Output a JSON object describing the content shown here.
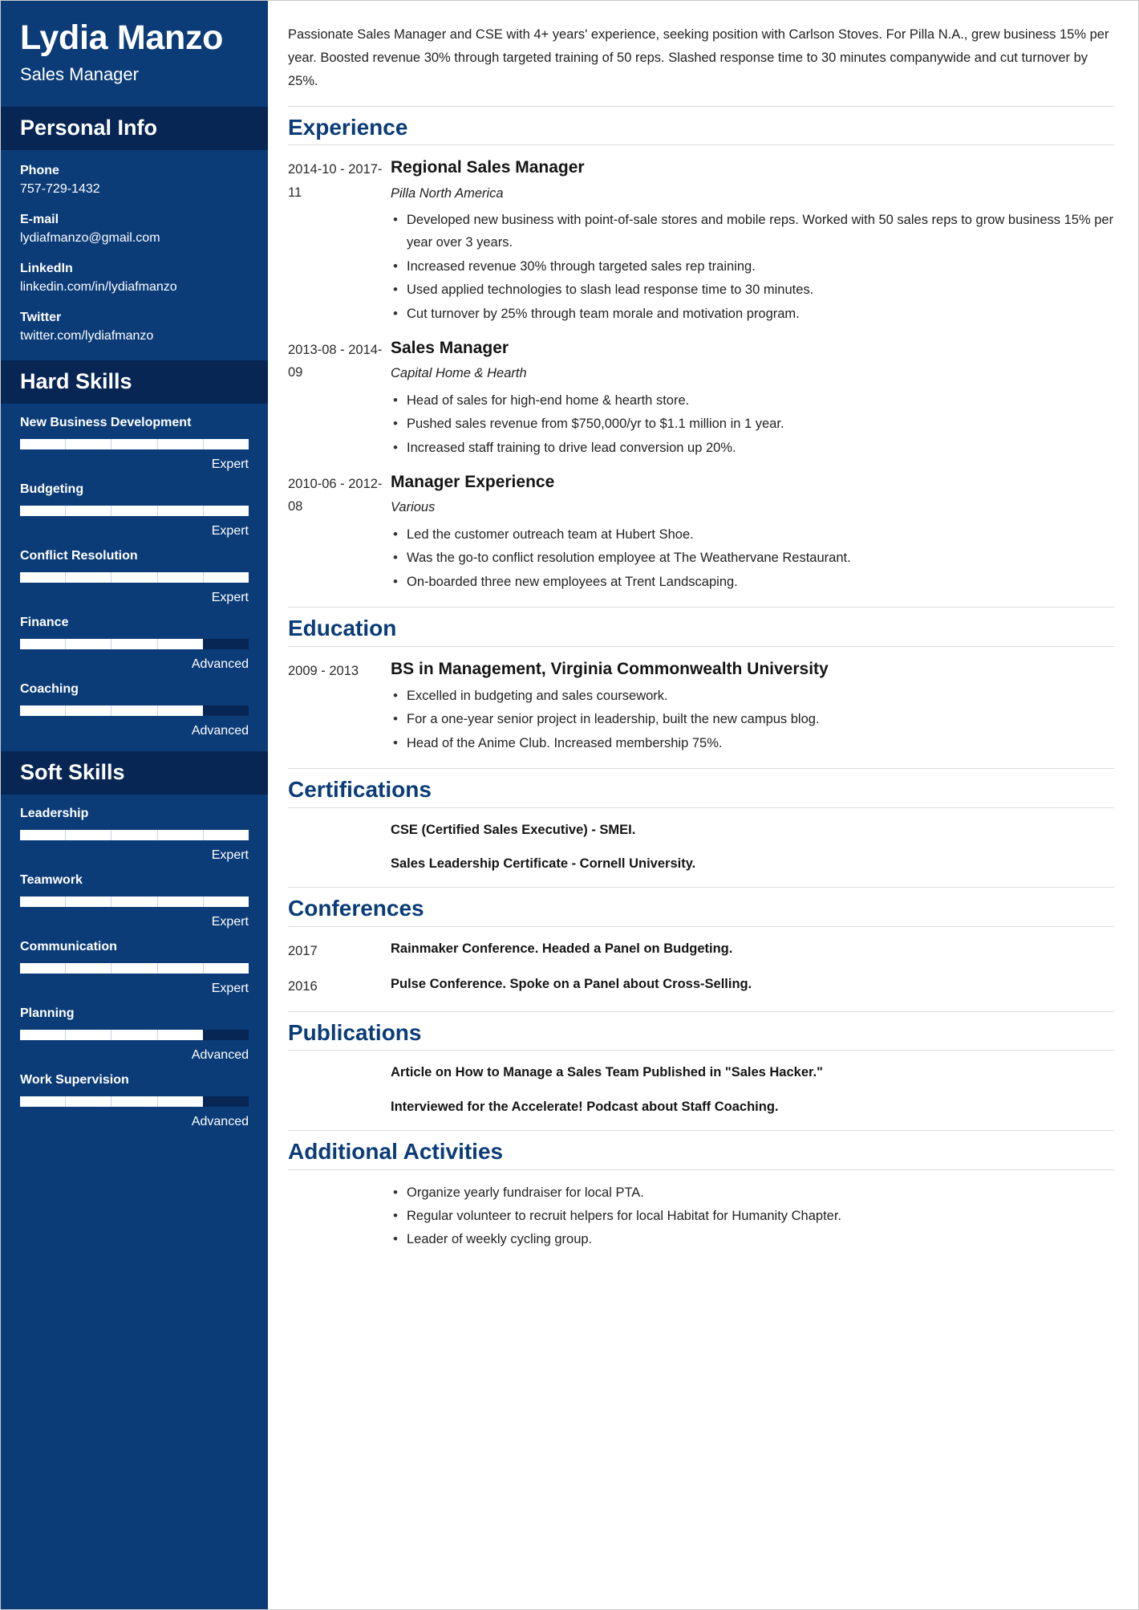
{
  "sidebar": {
    "full_name": "Lydia Manzo",
    "job_title": "Sales Manager",
    "personal_info": {
      "heading": "Personal Info",
      "items": [
        {
          "label": "Phone",
          "value": "757-729-1432"
        },
        {
          "label": "E-mail",
          "value": "lydiafmanzo@gmail.com"
        },
        {
          "label": "LinkedIn",
          "value": "linkedin.com/in/lydiafmanzo"
        },
        {
          "label": "Twitter",
          "value": "twitter.com/lydiafmanzo"
        }
      ]
    },
    "hard_skills": {
      "heading": "Hard Skills",
      "items": [
        {
          "name": "New Business Development",
          "level": "Expert",
          "percent": 100
        },
        {
          "name": "Budgeting",
          "level": "Expert",
          "percent": 100
        },
        {
          "name": "Conflict Resolution",
          "level": "Expert",
          "percent": 100
        },
        {
          "name": "Finance",
          "level": "Advanced",
          "percent": 80
        },
        {
          "name": "Coaching",
          "level": "Advanced",
          "percent": 80
        }
      ]
    },
    "soft_skills": {
      "heading": "Soft Skills",
      "items": [
        {
          "name": "Leadership",
          "level": "Expert",
          "percent": 100
        },
        {
          "name": "Teamwork",
          "level": "Expert",
          "percent": 100
        },
        {
          "name": "Communication",
          "level": "Expert",
          "percent": 100
        },
        {
          "name": "Planning",
          "level": "Advanced",
          "percent": 80
        },
        {
          "name": "Work Supervision",
          "level": "Advanced",
          "percent": 80
        }
      ]
    }
  },
  "main": {
    "summary": "Passionate Sales Manager and CSE with 4+ years' experience, seeking position with Carlson Stoves. For Pilla N.A., grew business 15% per year. Boosted revenue 30% through targeted training of 50 reps. Slashed response time to 30 minutes companywide and cut turnover by 25%.",
    "experience": {
      "heading": "Experience",
      "entries": [
        {
          "date": "2014-10 - 2017-11",
          "title": "Regional Sales Manager",
          "subtitle": "Pilla North America",
          "bullets": [
            "Developed new business with point-of-sale stores and mobile reps. Worked with 50 sales reps to grow business 15% per year over 3 years.",
            "Increased revenue 30% through targeted sales rep training.",
            "Used applied technologies to slash lead response time to 30 minutes.",
            "Cut turnover by 25% through team morale and motivation program."
          ]
        },
        {
          "date": "2013-08 - 2014-09",
          "title": "Sales Manager",
          "subtitle": "Capital Home & Hearth",
          "bullets": [
            "Head of sales for high-end home & hearth store.",
            "Pushed sales revenue from $750,000/yr to $1.1 million in 1 year.",
            "Increased staff training to drive lead conversion up 20%."
          ]
        },
        {
          "date": "2010-06 - 2012-08",
          "title": "Manager Experience",
          "subtitle": "Various",
          "bullets": [
            "Led the customer outreach team at Hubert Shoe.",
            "Was the go-to conflict resolution employee at The Weathervane Restaurant.",
            "On-boarded three new employees at Trent Landscaping."
          ]
        }
      ]
    },
    "education": {
      "heading": "Education",
      "entries": [
        {
          "date": "2009 - 2013",
          "title": "BS in Management, Virginia Commonwealth University",
          "bullets": [
            "Excelled in budgeting and sales coursework.",
            "For a one-year senior project in leadership, built the new campus blog.",
            "Head of the Anime Club. Increased membership 75%."
          ]
        }
      ]
    },
    "certifications": {
      "heading": "Certifications",
      "items": [
        "CSE (Certified Sales Executive) - SMEI.",
        "Sales Leadership Certificate - Cornell University."
      ]
    },
    "conferences": {
      "heading": "Conferences",
      "entries": [
        {
          "date": "2017",
          "text": "Rainmaker Conference. Headed a Panel on Budgeting."
        },
        {
          "date": "2016",
          "text": "Pulse Conference. Spoke on a Panel about Cross-Selling."
        }
      ]
    },
    "publications": {
      "heading": "Publications",
      "items": [
        "Article on How to Manage a Sales Team Published in \"Sales Hacker.\"",
        "Interviewed for the Accelerate! Podcast about Staff Coaching."
      ]
    },
    "additional_activities": {
      "heading": "Additional Activities",
      "bullets": [
        "Organize yearly fundraiser for local PTA.",
        "Regular volunteer to recruit helpers for local Habitat for Humanity Chapter.",
        "Leader of weekly cycling group."
      ]
    }
  },
  "colors": {
    "sidebar_bg": "#0b3c78",
    "sidebar_header_bg": "#072654",
    "accent": "#0b3c78",
    "rule": "#dcdcdc"
  }
}
